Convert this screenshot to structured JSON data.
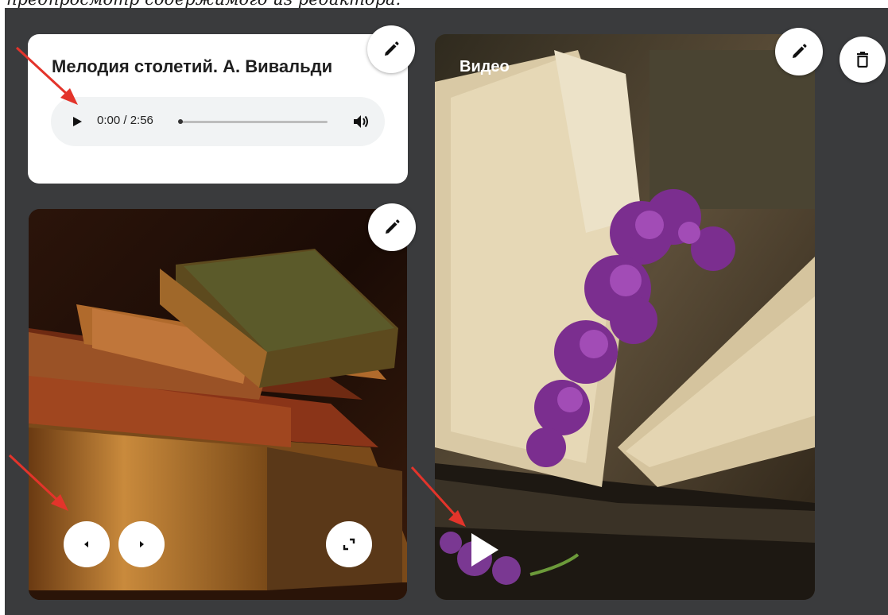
{
  "caption": "предпросмотр содержимого из редактора.",
  "audio": {
    "title": "Мелодия столетий. А. Вивальди",
    "time": "0:00 / 2:56",
    "progress": 0
  },
  "video": {
    "label": "Видео"
  },
  "icons": {
    "edit": "pencil-icon",
    "delete": "trash-icon",
    "prev": "chevron-left-icon",
    "next": "chevron-right-icon",
    "fullscreen": "expand-icon",
    "play": "play-icon",
    "volume": "volume-icon"
  },
  "colors": {
    "board": "#3a3b3d",
    "card": "#ffffff",
    "arrow": "#e3342b"
  }
}
